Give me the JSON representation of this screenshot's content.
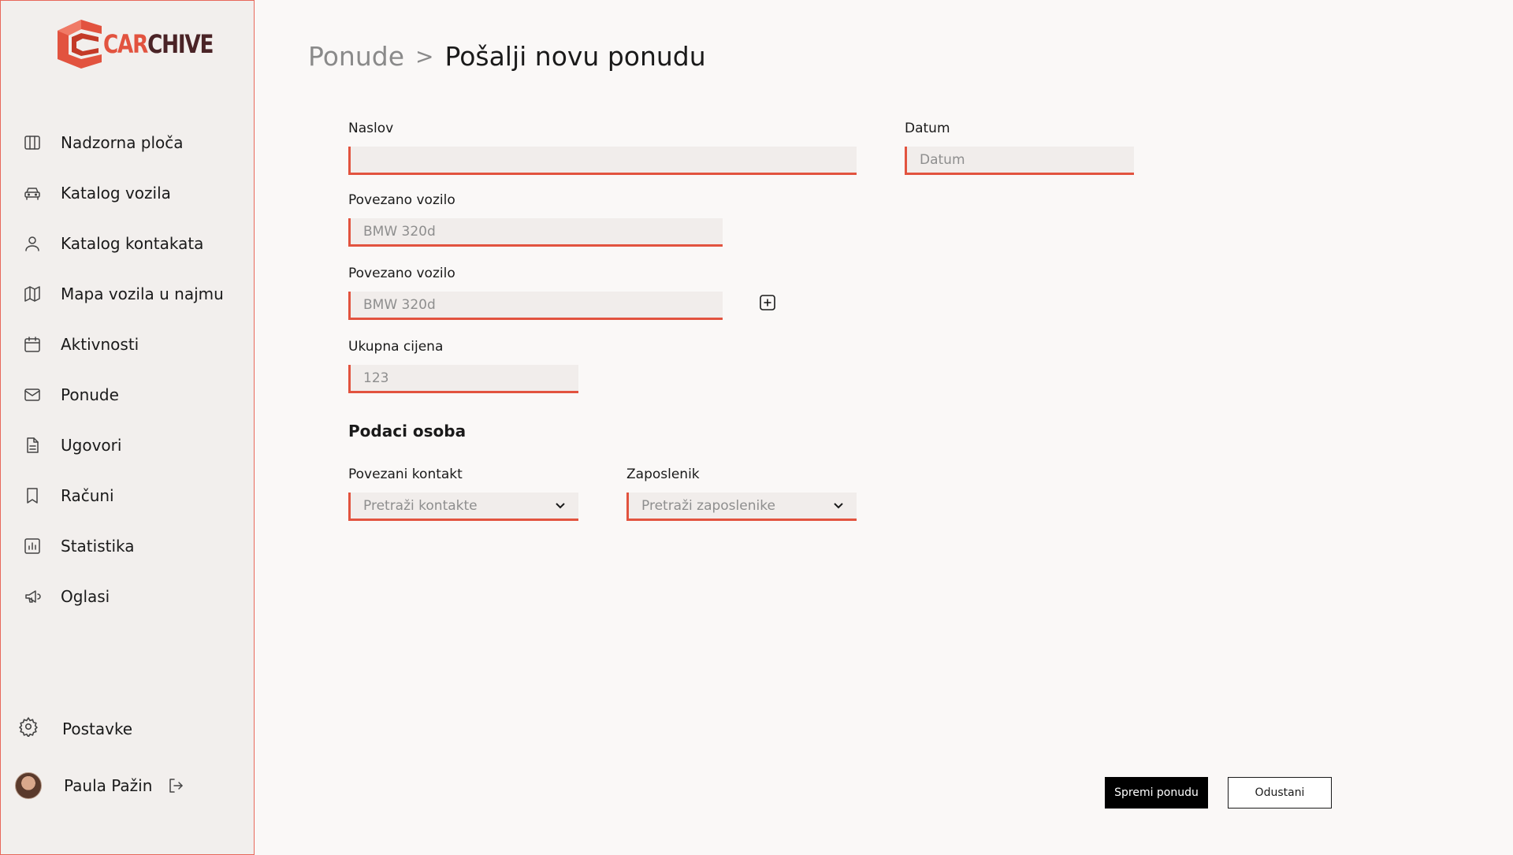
{
  "app": {
    "brand_part1": "CAR",
    "brand_part2": "CHIVE"
  },
  "sidebar": {
    "items": [
      {
        "label": "Nadzorna ploča",
        "icon": "dashboard-icon"
      },
      {
        "label": "Katalog vozila",
        "icon": "car-icon"
      },
      {
        "label": "Katalog kontakata",
        "icon": "user-icon"
      },
      {
        "label": "Mapa vozila u najmu",
        "icon": "map-icon"
      },
      {
        "label": "Aktivnosti",
        "icon": "calendar-icon"
      },
      {
        "label": "Ponude",
        "icon": "mail-icon"
      },
      {
        "label": "Ugovori",
        "icon": "document-icon"
      },
      {
        "label": "Računi",
        "icon": "receipt-icon"
      },
      {
        "label": "Statistika",
        "icon": "chart-icon"
      },
      {
        "label": "Oglasi",
        "icon": "megaphone-icon"
      }
    ],
    "settings_label": "Postavke",
    "user_name": "Paula Pažin"
  },
  "breadcrumb": {
    "parent": "Ponude",
    "separator": ">",
    "current": "Pošalji novu ponudu"
  },
  "form": {
    "naslov_label": "Naslov",
    "naslov_value": "",
    "datum_label": "Datum",
    "datum_placeholder": "Datum",
    "vozilo1_label": "Povezano vozilo",
    "vozilo1_placeholder": "BMW 320d",
    "vozilo2_label": "Povezano vozilo",
    "vozilo2_placeholder": "BMW 320d",
    "cijena_label": "Ukupna cijena",
    "cijena_placeholder": "123",
    "section_title": "Podaci osoba",
    "kontakt_label": "Povezani kontakt",
    "kontakt_placeholder": "Pretraži kontakte",
    "zaposlenik_label": "Zaposlenik",
    "zaposlenik_placeholder": "Pretraži zaposlenike"
  },
  "actions": {
    "save_label": "Spremi ponudu",
    "cancel_label": "Odustani"
  },
  "colors": {
    "accent": "#e2533f",
    "sidebar_bg": "#f2efed",
    "field_bg": "#f1edeb",
    "primary_button": "#000000"
  }
}
